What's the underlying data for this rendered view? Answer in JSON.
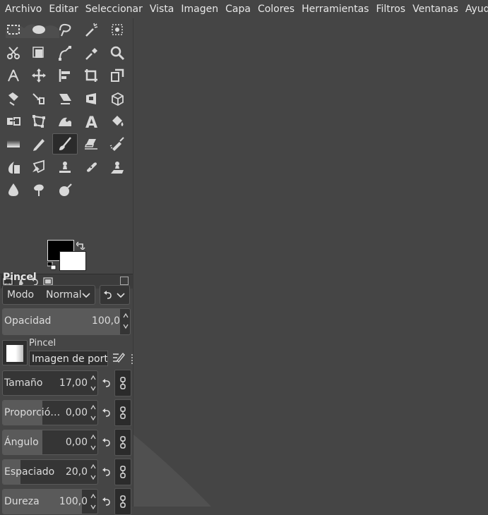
{
  "menu": [
    "Archivo",
    "Editar",
    "Seleccionar",
    "Vista",
    "Imagen",
    "Capa",
    "Colores",
    "Herramientas",
    "Filtros",
    "Ventanas",
    "Ayuda"
  ],
  "toolbox": {
    "tools": [
      "rect-select-icon",
      "ellipse-select-icon",
      "free-select-icon",
      "fuzzy-select-icon",
      "color-select-icon",
      "scissors-select-icon",
      "foreground-select-icon",
      "paths-icon",
      "color-picker-icon",
      "zoom-icon",
      "measure-icon",
      "move-icon",
      "align-icon",
      "crop-icon",
      "unified-transform-icon",
      "rotate-icon",
      "scale-icon",
      "shear-icon",
      "perspective-icon",
      "3d-transform-icon",
      "flip-icon",
      "cage-transform-icon",
      "warp-transform-icon",
      "text-icon",
      "bucket-fill-icon",
      "gradient-icon",
      "pencil-icon",
      "paintbrush-icon",
      "eraser-icon",
      "airbrush-icon",
      "ink-icon",
      "mypaint-brush-icon",
      "clone-icon",
      "heal-icon",
      "perspective-clone-icon",
      "blur-icon",
      "smudge-icon",
      "dodge-burn-icon"
    ],
    "active_tool": "paintbrush-icon",
    "fg_color": "#000000",
    "bg_color": "#ffffff"
  },
  "tool_options": {
    "title": "Pincel",
    "mode_label": "Modo",
    "mode_value": "Normal",
    "opacity_label": "Opacidad",
    "opacity_value": "100,0",
    "opacity_fraction": 1.0,
    "brush_label": "Pincel",
    "brush_name": "Imagen de portapapeles",
    "params": [
      {
        "label": "Tamaño",
        "value": "17,00",
        "fill": 0.0
      },
      {
        "label": "Proporció…",
        "value": "0,00",
        "fill": 0.45
      },
      {
        "label": "Ángulo",
        "value": "0,00",
        "fill": 0.45
      },
      {
        "label": "Espaciado",
        "value": "20,0",
        "fill": 0.2
      },
      {
        "label": "Dureza",
        "value": "100,0",
        "fill": 0.9
      }
    ]
  }
}
